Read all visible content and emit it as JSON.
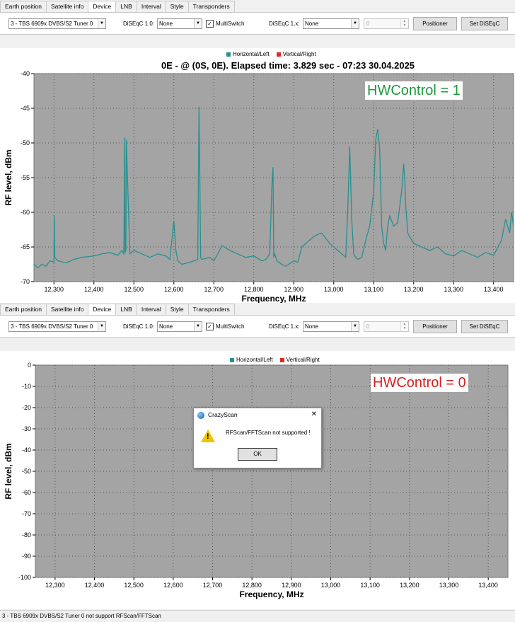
{
  "tabs": [
    "Earth position",
    "Satellite info",
    "Device",
    "LNB",
    "Interval",
    "Style",
    "Transponders"
  ],
  "active_tab": "Device",
  "toolbar": {
    "tuner_select": "3 - TBS 6909x DVBS/S2 Tuner 0",
    "diseqc10_label": "DiSEqC 1.0:",
    "diseqc10_value": "None",
    "multiswitch_label": "MultiSwitch",
    "multiswitch_checked": true,
    "diseqc1x_label": "DiSEqC 1.x:",
    "diseqc1x_value": "None",
    "position_value": "0",
    "positioner_button": "Positioner",
    "set_diseqc_button": "Set DiSEqC"
  },
  "legend": {
    "horizontal": "Horizontal/Left",
    "vertical": "Vertical/Right",
    "horizontal_color": "#2a8f8f",
    "vertical_color": "#e02828"
  },
  "chart_top": {
    "title": "0E -  @  (0S, 0E). Elapsed time: 3.829 sec - 07:23 30.04.2025",
    "annotation": "HWControl = 1",
    "annotation_color": "#1a9a3a",
    "ylabel": "RF level, dBm",
    "xlabel": "Frequency, MHz",
    "y_ticks": [
      "-40",
      "-45",
      "-50",
      "-55",
      "-60",
      "-65",
      "-70"
    ],
    "x_ticks": [
      "12,300",
      "12,400",
      "12,500",
      "12,600",
      "12,700",
      "12,800",
      "12,900",
      "13,000",
      "13,100",
      "13,200",
      "13,300",
      "13,400"
    ]
  },
  "chart_bottom": {
    "annotation": "HWControl = 0",
    "annotation_color": "#d42020",
    "ylabel": "RF level, dBm",
    "xlabel": "Frequency, MHz",
    "y_ticks": [
      "0",
      "-10",
      "-20",
      "-30",
      "-40",
      "-50",
      "-60",
      "-70",
      "-80",
      "-90",
      "-100"
    ],
    "x_ticks": [
      "12,300",
      "12,400",
      "12,500",
      "12,600",
      "12,700",
      "12,800",
      "12,900",
      "13,000",
      "13,100",
      "13,200",
      "13,300",
      "13,400"
    ]
  },
  "dialog": {
    "title": "CrazyScan",
    "message": "RFScan/FFTScan not supported !",
    "ok_button": "OK",
    "close_glyph": "✕"
  },
  "status_bar": "3 - TBS 6909x DVBS/S2 Tuner 0 not support RFScan/FFTScan",
  "chart_data": [
    {
      "type": "line",
      "title": "0E -  @  (0S, 0E). Elapsed time: 3.829 sec - 07:23 30.04.2025",
      "xlabel": "Frequency, MHz",
      "ylabel": "RF level, dBm",
      "xlim": [
        12250,
        13450
      ],
      "ylim": [
        -70,
        -40
      ],
      "grid": true,
      "legend": "top-center",
      "series": [
        {
          "name": "Horizontal/Left",
          "color": "#2a8f8f",
          "x": [
            12250,
            12260,
            12270,
            12280,
            12290,
            12300,
            12301,
            12302,
            12310,
            12330,
            12350,
            12370,
            12400,
            12420,
            12440,
            12460,
            12470,
            12475,
            12477,
            12478,
            12480,
            12481,
            12490,
            12500,
            12520,
            12540,
            12560,
            12580,
            12590,
            12600,
            12605,
            12610,
            12620,
            12640,
            12650,
            12660,
            12663,
            12665,
            12667,
            12670,
            12690,
            12700,
            12710,
            12720,
            12740,
            12760,
            12780,
            12800,
            12820,
            12830,
            12840,
            12845,
            12848,
            12850,
            12852,
            12858,
            12870,
            12880,
            12900,
            12910,
            12920,
            12930,
            12940,
            12950,
            12960,
            12970,
            12990,
            13000,
            13010,
            13020,
            13030,
            13035,
            13040,
            13045,
            13050,
            13055,
            13060,
            13070,
            13080,
            13090,
            13100,
            13105,
            13110,
            13115,
            13120,
            13125,
            13130,
            13135,
            13140,
            13150,
            13160,
            13170,
            13175,
            13178,
            13180,
            13185,
            13190,
            13200,
            13220,
            13240,
            13260,
            13280,
            13300,
            13320,
            13340,
            13360,
            13380,
            13400,
            13420,
            13430,
            13440,
            13445,
            13450
          ],
          "values": [
            -67.5,
            -68,
            -67.5,
            -67.8,
            -67,
            -67.2,
            -60.5,
            -66.5,
            -67,
            -67.3,
            -66.8,
            -66.5,
            -66.3,
            -66,
            -65.8,
            -66.2,
            -65.5,
            -66,
            -49.2,
            -65.8,
            -65.5,
            -49.5,
            -66,
            -65.5,
            -66,
            -66.5,
            -66,
            -66.3,
            -66.8,
            -61.2,
            -65.5,
            -67,
            -67.5,
            -67.2,
            -67,
            -66.8,
            -44.8,
            -55,
            -66.5,
            -66.8,
            -66.5,
            -67,
            -66,
            -64.8,
            -65.5,
            -66,
            -66.5,
            -66.3,
            -67,
            -66.8,
            -66,
            -56.5,
            -53.5,
            -66.5,
            -66,
            -67,
            -67.5,
            -67.8,
            -67,
            -67.2,
            -65,
            -64.5,
            -64,
            -63.5,
            -63.2,
            -63,
            -64.5,
            -65,
            -65.5,
            -66,
            -66.5,
            -60,
            -50.5,
            -61,
            -66,
            -66.5,
            -66.8,
            -66.5,
            -64,
            -62,
            -57,
            -49.5,
            -48,
            -51,
            -62,
            -64.5,
            -65.5,
            -62,
            -60.5,
            -62,
            -61.5,
            -57,
            -53,
            -55.5,
            -59,
            -63,
            -63.5,
            -64.5,
            -65,
            -65.5,
            -65,
            -66,
            -66.3,
            -65.5,
            -66,
            -66.5,
            -65.8,
            -66.2,
            -64,
            -61,
            -63,
            -60,
            -62
          ]
        }
      ]
    },
    {
      "type": "line",
      "xlabel": "Frequency, MHz",
      "ylabel": "RF level, dBm",
      "xlim": [
        12250,
        13450
      ],
      "ylim": [
        -100,
        0
      ],
      "grid": true,
      "legend": "top-center",
      "series": []
    }
  ]
}
